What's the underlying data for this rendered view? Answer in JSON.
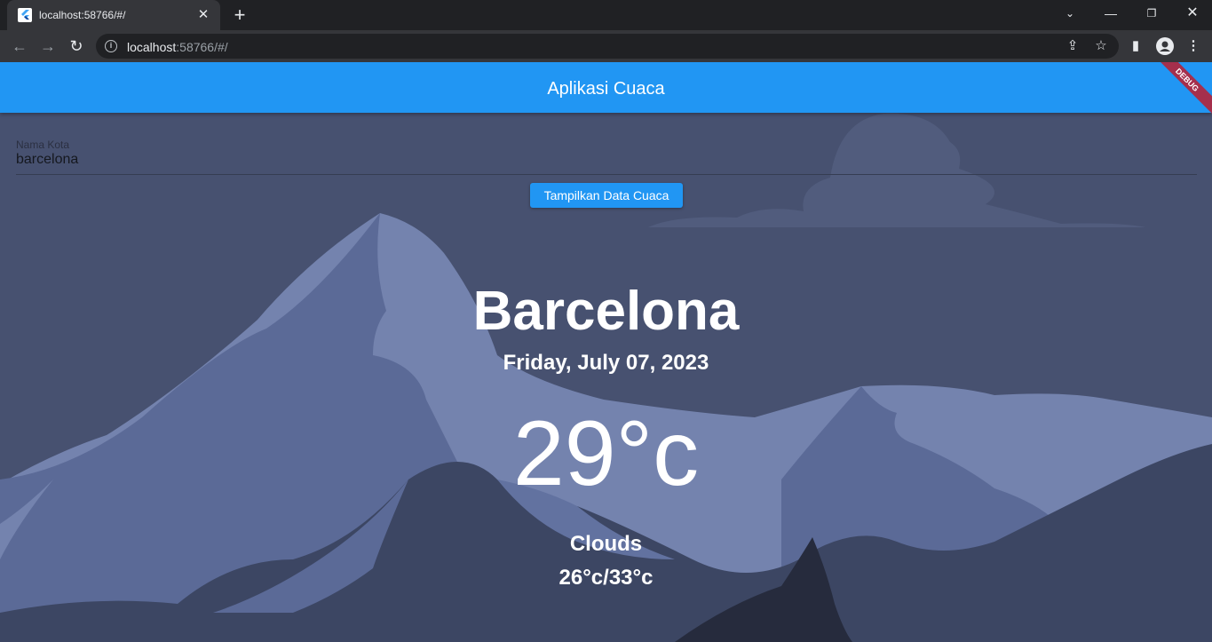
{
  "browser": {
    "tab_title": "localhost:58766/#/",
    "url_host": "localhost",
    "url_rest": ":58766/#/"
  },
  "app": {
    "title": "Aplikasi Cuaca",
    "debug_banner": "DEBUG",
    "city_field": {
      "label": "Nama Kota",
      "value": "barcelona"
    },
    "submit_label": "Tampilkan Data Cuaca",
    "weather": {
      "city": "Barcelona",
      "date": "Friday, July 07, 2023",
      "temperature": "29°c",
      "condition": "Clouds",
      "min_max": "26°c/33°c"
    }
  },
  "colors": {
    "appbar": "#2196f3",
    "background": "#475170",
    "mountain_light": "#7483ae",
    "mountain_mid": "#5b6a97",
    "mountain_dark": "#3c4663"
  }
}
